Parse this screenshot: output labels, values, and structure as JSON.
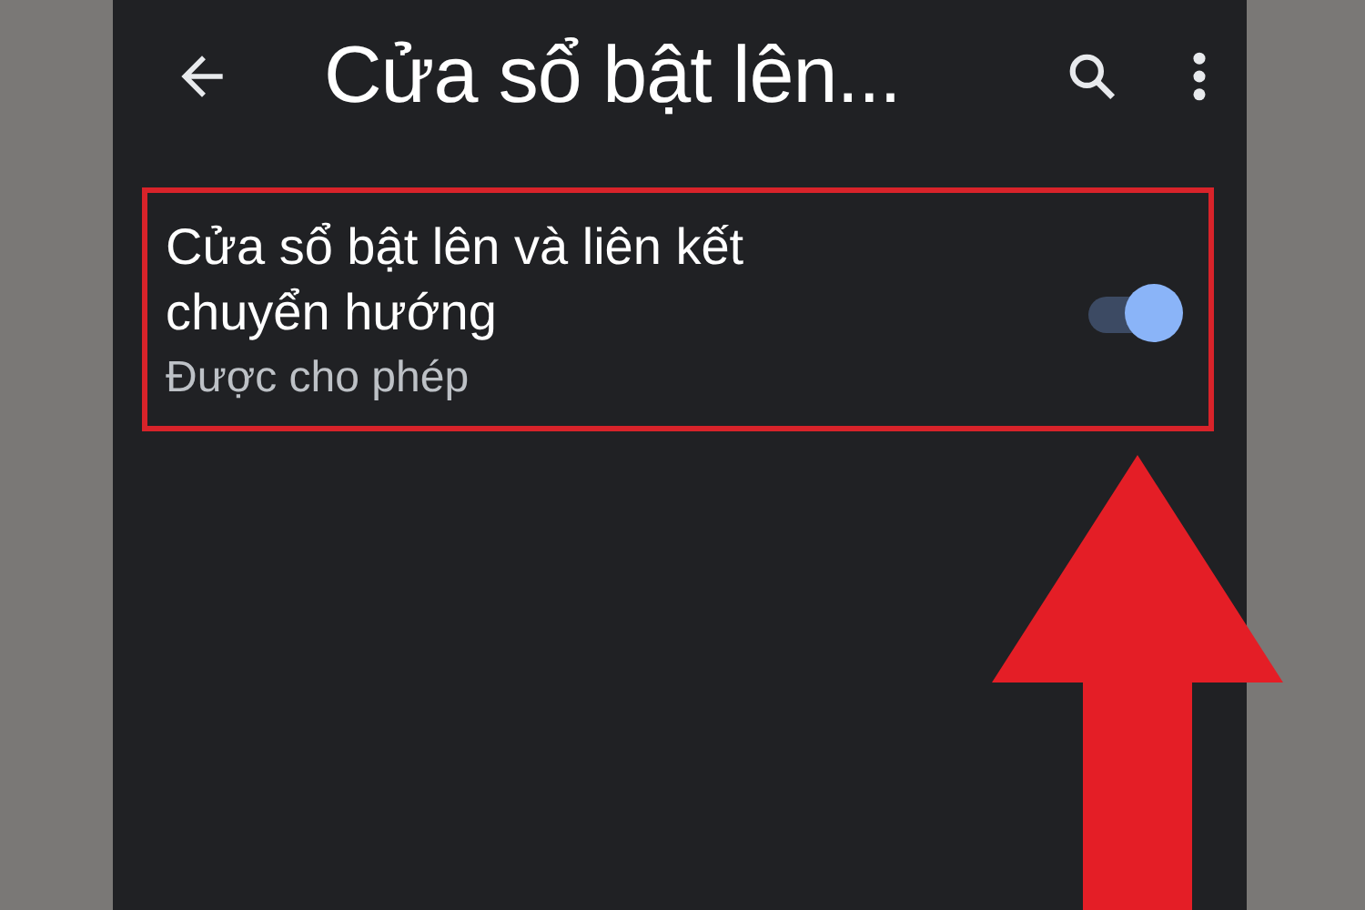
{
  "app_bar": {
    "title": "Cửa sổ bật lên..."
  },
  "setting": {
    "title": "Cửa sổ bật lên và liên kết chuyển hướng",
    "summary": "Được cho phép",
    "on": true,
    "highlighted": true
  },
  "annotation": {
    "kind": "arrow"
  }
}
